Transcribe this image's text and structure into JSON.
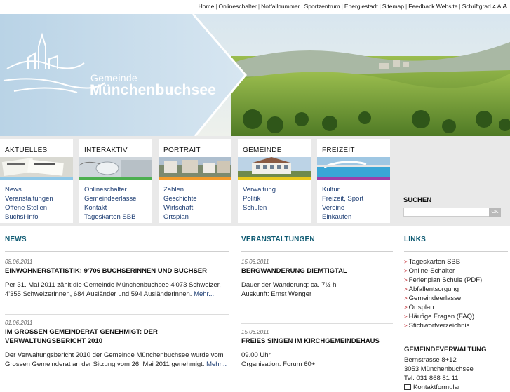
{
  "topnav": {
    "items": [
      "Home",
      "Onlineschalter",
      "Notfallnummer",
      "Sportzentrum",
      "Energiestadt",
      "Sitemap",
      "Feedback Website"
    ],
    "font_size_label": "Schriftgrad",
    "font_size_options": [
      "A",
      "A",
      "A"
    ]
  },
  "brand": {
    "line1": "Gemeinde",
    "line2": "Münchenbuchsee"
  },
  "categories": [
    {
      "title": "AKTUELLES",
      "color": "#8fc8e8",
      "links": [
        "News",
        "Veranstaltungen",
        "Offene Stellen",
        "Buchsi-Info"
      ]
    },
    {
      "title": "INTERAKTIV",
      "color": "#4caf50",
      "links": [
        "Onlineschalter",
        "Gemeindeerlasse",
        "Kontakt",
        "Tageskarten SBB"
      ]
    },
    {
      "title": "PORTRAIT",
      "color": "#f39b2b",
      "links": [
        "Zahlen",
        "Geschichte",
        "Wirtschaft",
        "Ortsplan"
      ]
    },
    {
      "title": "GEMEINDE",
      "color": "#e9c81b",
      "links": [
        "Verwaltung",
        "Politik",
        "Schulen"
      ]
    },
    {
      "title": "FREIZEIT",
      "color": "#9c3fa8",
      "links": [
        "Kultur",
        "Freizeit, Sport",
        "Vereine",
        "Einkaufen"
      ]
    }
  ],
  "search": {
    "title": "SUCHEN",
    "placeholder": "",
    "button": "OK"
  },
  "news": {
    "heading": "NEWS",
    "items": [
      {
        "date": "08.06.2011",
        "title": "EINWOHNERSTATISTIK: 9'706 BUCHSERINNEN UND BUCHSER",
        "body": "Per 31. Mai 2011 zählt die Gemeinde Münchenbuchsee 4'073 Schweizer, 4'355 Schweizerinnen, 684 Ausländer und 594 Ausländerinnen.",
        "more": "Mehr..."
      },
      {
        "date": "01.06.2011",
        "title": "IM GROSSEN GEMEINDERAT GENEHMIGT: DER VERWALTUNGSBERICHT 2010",
        "body": "Der Verwaltungsbericht 2010 der Gemeinde Münchenbuchsee wurde vom Grossen Gemeinderat an der Sitzung vom 26. Mai 2011 genehmigt.",
        "more": "Mehr..."
      }
    ]
  },
  "events": {
    "heading": "VERANSTALTUNGEN",
    "items": [
      {
        "date": "15.06.2011",
        "title": "BERGWANDERUNG DIEMTIGTAL",
        "lines": [
          "Dauer der Wanderung: ca. 7½ h",
          "Auskunft: Ernst Wenger"
        ]
      },
      {
        "date": "15.06.2011",
        "title": "FREIES SINGEN IM KIRCHGEMEINDEHAUS",
        "lines": [
          "09.00 Uhr",
          "Organisation: Forum 60+"
        ]
      }
    ]
  },
  "links": {
    "heading": "LINKS",
    "items": [
      "Tageskarten SBB",
      "Online-Schalter",
      "Ferienplan Schule (PDF)",
      "Abfallentsorgung",
      "Gemeindeerlasse",
      "Ortsplan",
      "Häufige Fragen (FAQ)",
      "Stichwortverzeichnis"
    ],
    "arrow": ">"
  },
  "admin": {
    "title": "GEMEINDEVERWALTUNG",
    "lines": [
      "Bernstrasse 8+12",
      "3053 Münchenbuchsee",
      "Tel. 031 868 81 11",
      "Kontaktformular"
    ]
  }
}
